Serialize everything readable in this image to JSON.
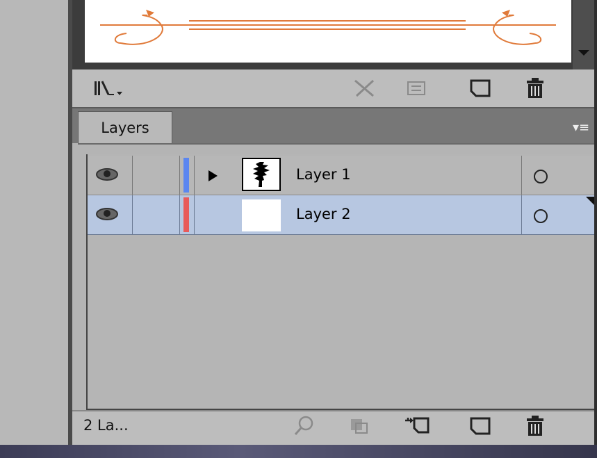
{
  "layers_panel": {
    "tab_label": "Layers",
    "footer_count": "2 La...",
    "layers": [
      {
        "name": "Layer 1",
        "color": "#5b86f0",
        "expanded": false,
        "selected": false,
        "thumbnail": "tree-silhouette"
      },
      {
        "name": "Layer 2",
        "color": "#e85a5a",
        "selected": true,
        "thumbnail": "blank"
      }
    ]
  },
  "colors": {
    "selected_row": "#b7c7e1",
    "panel_bg": "#b4b4b4",
    "swatch_ornament": "#e07a3a"
  },
  "icons": {
    "swatch_toolbar": [
      "swatch-libraries-icon",
      "break-link-icon",
      "options-icon",
      "new-swatch-icon",
      "trash-icon"
    ],
    "layers_footer": [
      "locate-object-icon",
      "make-clip-mask-icon",
      "new-sublayer-icon",
      "new-layer-icon",
      "trash-icon"
    ]
  }
}
